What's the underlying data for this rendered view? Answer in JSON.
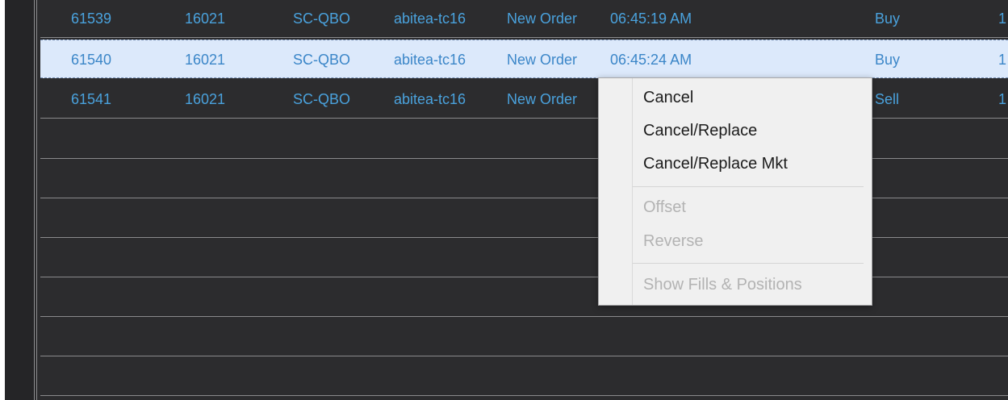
{
  "orders": [
    {
      "order_id": "61539",
      "account": "16021",
      "symbol": "SC-QBO",
      "user": "abitea-tc16",
      "status": "New Order",
      "time": "06:45:19 AM",
      "side": "Buy",
      "qty": "1"
    },
    {
      "order_id": "61540",
      "account": "16021",
      "symbol": "SC-QBO",
      "user": "abitea-tc16",
      "status": "New Order",
      "time": "06:45:24 AM",
      "side": "Buy",
      "qty": "1"
    },
    {
      "order_id": "61541",
      "account": "16021",
      "symbol": "SC-QBO",
      "user": "abitea-tc16",
      "status": "New Order",
      "time": "",
      "side": "Sell",
      "qty": "1"
    }
  ],
  "context_menu": {
    "items": [
      {
        "label": "Cancel",
        "enabled": true
      },
      {
        "label": "Cancel/Replace",
        "enabled": true
      },
      {
        "label": "Cancel/Replace Mkt",
        "enabled": true
      },
      {
        "label": "Offset",
        "enabled": false
      },
      {
        "label": "Reverse",
        "enabled": false
      },
      {
        "label": "Show Fills & Positions",
        "enabled": false
      }
    ]
  },
  "colors": {
    "grid_background": "#2c2c2e",
    "row_text": "#4aa2dd",
    "selected_row_background": "#dce9fb",
    "menu_background": "#f0f0f0",
    "menu_text": "#1c1c1c",
    "menu_disabled_text": "#b3b3b3"
  }
}
